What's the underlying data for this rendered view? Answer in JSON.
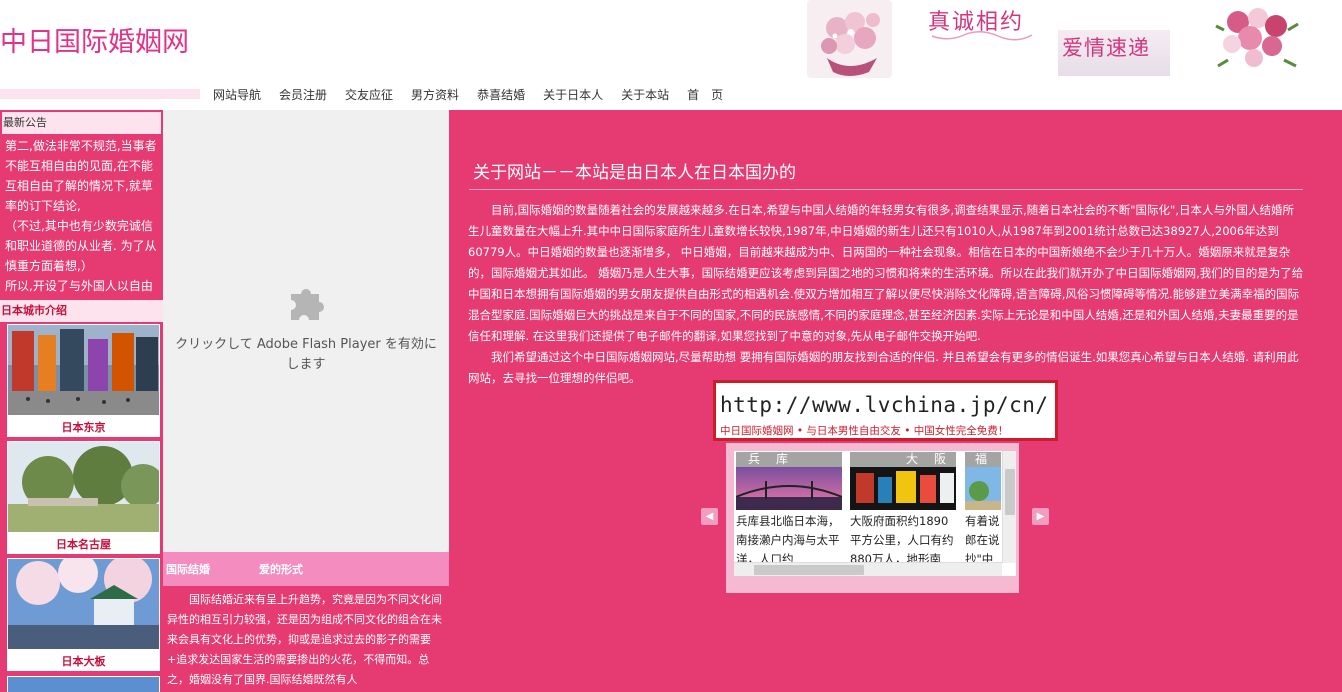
{
  "header": {
    "site_title": "中日国际婚姻网",
    "calligraphy_1": "真诚相约",
    "calligraphy_2": "爱情速递"
  },
  "nav": [
    {
      "label": "网站导航"
    },
    {
      "label": "会员注册"
    },
    {
      "label": "交友应征"
    },
    {
      "label": "男方资料"
    },
    {
      "label": "恭喜结婚"
    },
    {
      "label": "关于日本人"
    },
    {
      "label": "关于本站"
    },
    {
      "label": "首　页"
    }
  ],
  "notice": {
    "title": "最新公告",
    "paragraphs": [
      "第二,做法非常不规范,当事者不能互相自由的见面,在不能互相自由了解的情况下,就草率的订下结论,",
      "（不过,其中也有少数完诚信和职业道德的从业者. 为了从慎重方面着想,）",
      "所以,开设了与外国人以自由相识会为目的的「日英翻"
    ]
  },
  "cities": {
    "title": "日本城市介绍",
    "items": [
      {
        "caption": "日本东京"
      },
      {
        "caption": "日本名古屋"
      },
      {
        "caption": "日本大板"
      }
    ]
  },
  "flash": {
    "message": "クリックして Adobe Flash Player を有効にします"
  },
  "intl": {
    "tab1": "国际结婚",
    "tab2": "爱的形式",
    "body": "国际结婚近来有呈上升趋势，究竟是因为不同文化间异性的相互引力较强，还是因为组成不同文化的组合在未来会具有文化上的优势，抑或是追求过去的影子的需要+追求发达国家生活的需要掺出的火花，不得而知。总之，婚姻没有了国界.国际结婚既然有人"
  },
  "main": {
    "title": "关于网站－－本站是由日本人在日本国办的",
    "paragraphs": [
      "目前,国际婚姻的数量随着社会的发展越来越多.在日本,希望与中国人结婚的年轻男女有很多,调查结果显示,随着日本社会的不断\"国际化\",日本人与外国人结婚所生儿童数量在大幅上升.其中中日国际家庭所生儿童数增长较快,1987年,中日婚姻的新生儿还只有1010人,从1987年到2001统计总数已达38927人,2006年达到60779人。中日婚姻的数量也逐渐增多，  中日婚姻，目前越来越成为中、日两国的一种社会现象。相信在日本的中国新娘绝不会少于几十万人。婚姻原来就是复杂的，国际婚姻尤其如此。 婚姻乃是人生大事，国际结婚更应该考虑到异国之地的习惯和将来的生活环境。所以在此我们就开办了中日国际婚姻网,我们的目的是为了给中国和日本想拥有国际婚姻的男女朋友提供自由形式的相遇机会.使双方增加相互了解以便尽快消除文化障碍,语言障碍,风俗习惯障碍等情况.能够建立美满幸福的国际混合型家庭.国际婚姻巨大的挑战是来自于不同的国家,不同的民族感情,不同的家庭理念,甚至经济因素.实际上无论是和中国人结婚,还是和外国人结婚,夫妻最重要的是信任和理解. 在这里我们还提供了电子邮件的翻译,如果您找到了中意的对象,先从电子邮件交换开始吧.",
      "我们希望通过这个中日国际婚姻网站,尽量帮助想 要拥有国际婚姻的朋友找到合适的伴侣. 并且希望会有更多的情侣诞生.如果您真心希望与日本人结婚. 请利用此网站，去寻找一位理想的伴侣吧。"
    ]
  },
  "banner": {
    "url": "http://www.lvchina.jp/cn/",
    "subtitle": "中日国际婚姻网 • 与日本男性自由交友 • 中国女性完全免费！"
  },
  "carousel": {
    "slides": [
      {
        "label": "兵　库",
        "desc": "兵库县北临日本海，南接濑户内海与太平洋，人口约"
      },
      {
        "label": "大　阪",
        "desc": "大阪府面积约1890平方公里，人口有约880万人，地形南"
      },
      {
        "label": "福",
        "desc": "有着说郎在说抄\"中尸"
      }
    ],
    "prev": "◀",
    "next": "▶",
    "colors": {
      "accent": "#e63a72",
      "panel": "#f6b9d2"
    }
  }
}
